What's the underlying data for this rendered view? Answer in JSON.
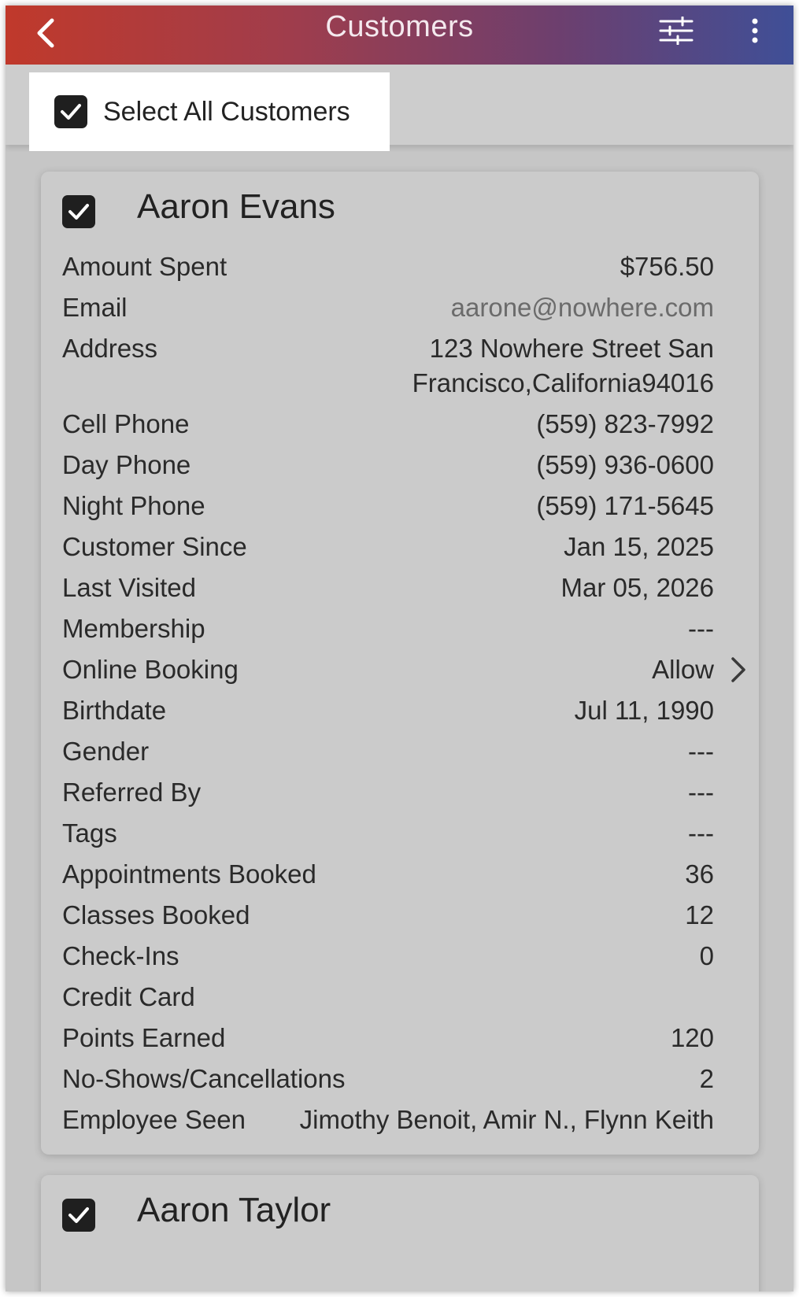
{
  "header": {
    "title": "Customers",
    "back_icon": "chevron-left-icon",
    "filter_icon": "sliders-icon",
    "more_icon": "more-vertical-icon"
  },
  "select_all": {
    "label": "Select All Customers",
    "checked": true
  },
  "colors": {
    "header_gradient": [
      "#c0392b",
      "#a13d4b",
      "#6d3f6e",
      "#3f4f97"
    ],
    "card_background": "#cbcbcb",
    "page_background": "#c6c6c6",
    "email_color": "#6b6b6b"
  },
  "customers": [
    {
      "name": "Aaron Evans",
      "checked": true,
      "fields": {
        "amount_spent": {
          "label": "Amount Spent",
          "value": "$756.50"
        },
        "email": {
          "label": "Email",
          "value": "aarone@nowhere.com"
        },
        "address": {
          "label": "Address",
          "value": "123 Nowhere Street San Francisco,California94016"
        },
        "cell_phone": {
          "label": "Cell Phone",
          "value": "(559) 823-7992"
        },
        "day_phone": {
          "label": "Day Phone",
          "value": "(559) 936-0600"
        },
        "night_phone": {
          "label": "Night Phone",
          "value": "(559) 171-5645"
        },
        "customer_since": {
          "label": "Customer Since",
          "value": "Jan 15, 2025"
        },
        "last_visited": {
          "label": "Last Visited",
          "value": "Mar 05, 2026"
        },
        "membership": {
          "label": "Membership",
          "value": "---"
        },
        "online_booking": {
          "label": "Online Booking",
          "value": "Allow"
        },
        "birthdate": {
          "label": "Birthdate",
          "value": "Jul 11, 1990"
        },
        "gender": {
          "label": "Gender",
          "value": "---"
        },
        "referred_by": {
          "label": "Referred By",
          "value": "---"
        },
        "tags": {
          "label": "Tags",
          "value": "---"
        },
        "appointments_booked": {
          "label": "Appointments Booked",
          "value": "36"
        },
        "classes_booked": {
          "label": "Classes Booked",
          "value": "12"
        },
        "check_ins": {
          "label": "Check-Ins",
          "value": "0"
        },
        "credit_card": {
          "label": "Credit Card",
          "value": ""
        },
        "points_earned": {
          "label": "Points Earned",
          "value": "120"
        },
        "no_shows": {
          "label": "No-Shows/Cancellations",
          "value": "2"
        },
        "employee_seen": {
          "label": "Employee Seen",
          "value": "Jimothy Benoit, Amir N., Flynn Keith"
        }
      }
    },
    {
      "name": "Aaron Taylor",
      "checked": true
    }
  ]
}
